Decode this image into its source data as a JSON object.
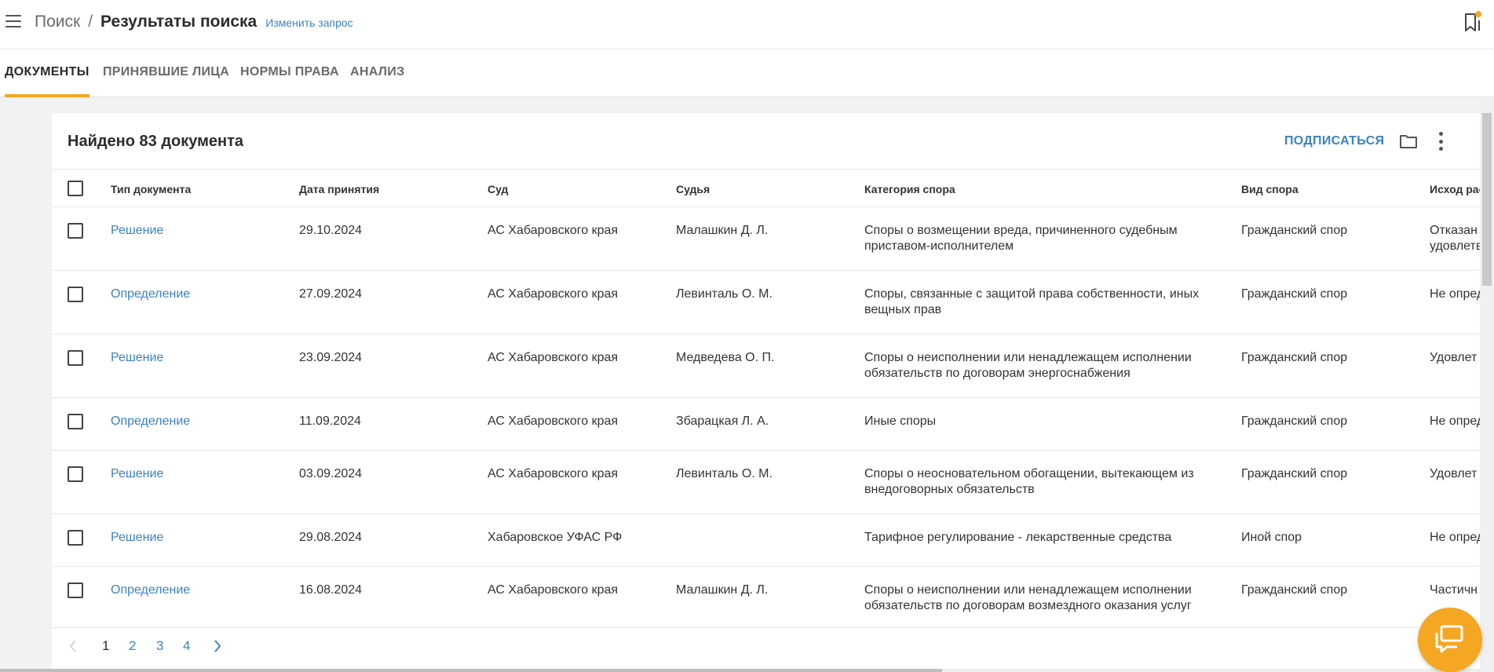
{
  "header": {
    "breadcrumb_root": "Поиск",
    "breadcrumb_separator": "/",
    "page_title": "Результаты поиска",
    "edit_query": "Изменить запрос"
  },
  "tabs": [
    {
      "label": "ДОКУМЕНТЫ",
      "active": true
    },
    {
      "label": "ПРИНЯВШИЕ ЛИЦА",
      "active": false
    },
    {
      "label": "НОРМЫ ПРАВА",
      "active": false
    },
    {
      "label": "АНАЛИЗ",
      "active": false
    }
  ],
  "results": {
    "found_text": "Найдено 83 документа",
    "subscribe_label": "ПОДПИСАТЬСЯ"
  },
  "table": {
    "columns": [
      "Тип документа",
      "Дата принятия",
      "Суд",
      "Судья",
      "Категория спора",
      "Вид спора",
      "Исход рас"
    ],
    "rows": [
      {
        "type": "Решение",
        "date": "29.10.2024",
        "court": "АС Хабаровского края",
        "judge": "Малашкин Д. Л.",
        "category": [
          "Споры о возмещении вреда, причиненного судебным",
          "приставом-исполнителем"
        ],
        "dispute": "Гражданский спор",
        "outcome": [
          "Отказан",
          "удовлетв"
        ]
      },
      {
        "type": "Определение",
        "date": "27.09.2024",
        "court": "АС Хабаровского края",
        "judge": "Левинталь О. М.",
        "category": [
          "Споры, связанные с защитой права собственности, иных",
          "вещных прав"
        ],
        "dispute": "Гражданский спор",
        "outcome": [
          "Не опред",
          ""
        ]
      },
      {
        "type": "Решение",
        "date": "23.09.2024",
        "court": "АС Хабаровского края",
        "judge": "Медведева О. П.",
        "category": [
          "Споры о неисполнении или ненадлежащем исполнении",
          "обязательств по договорам энергоснабжения"
        ],
        "dispute": "Гражданский спор",
        "outcome": [
          "Удовлет",
          ""
        ]
      },
      {
        "type": "Определение",
        "date": "11.09.2024",
        "court": "АС Хабаровского края",
        "judge": "Збарацкая Л. А.",
        "category": [
          "Иные споры",
          ""
        ],
        "dispute": "Гражданский спор",
        "outcome": [
          "Не опред",
          ""
        ]
      },
      {
        "type": "Решение",
        "date": "03.09.2024",
        "court": "АС Хабаровского края",
        "judge": "Левинталь О. М.",
        "category": [
          "Споры о неосновательном обогащении, вытекающем из",
          "внедоговорных обязательств"
        ],
        "dispute": "Гражданский спор",
        "outcome": [
          "Удовлет",
          ""
        ]
      },
      {
        "type": "Решение",
        "date": "29.08.2024",
        "court": "Хабаровское УФАС РФ",
        "judge": "",
        "category": [
          "Тарифное регулирование - лекарственные средства",
          ""
        ],
        "dispute": "Иной спор",
        "outcome": [
          "Не опред",
          ""
        ]
      },
      {
        "type": "Определение",
        "date": "16.08.2024",
        "court": "АС Хабаровского края",
        "judge": "Малашкин Д. Л.",
        "category": [
          "Споры о неисполнении или ненадлежащем исполнении",
          "обязательств по договорам возмездного оказания услуг"
        ],
        "dispute": "Гражданский спор",
        "outcome": [
          "Частичн",
          ""
        ]
      }
    ]
  },
  "pagination": {
    "pages": [
      "1",
      "2",
      "3",
      "4"
    ],
    "current": "1"
  },
  "colors": {
    "accent": "#f5a623",
    "link": "#3b82c4"
  }
}
